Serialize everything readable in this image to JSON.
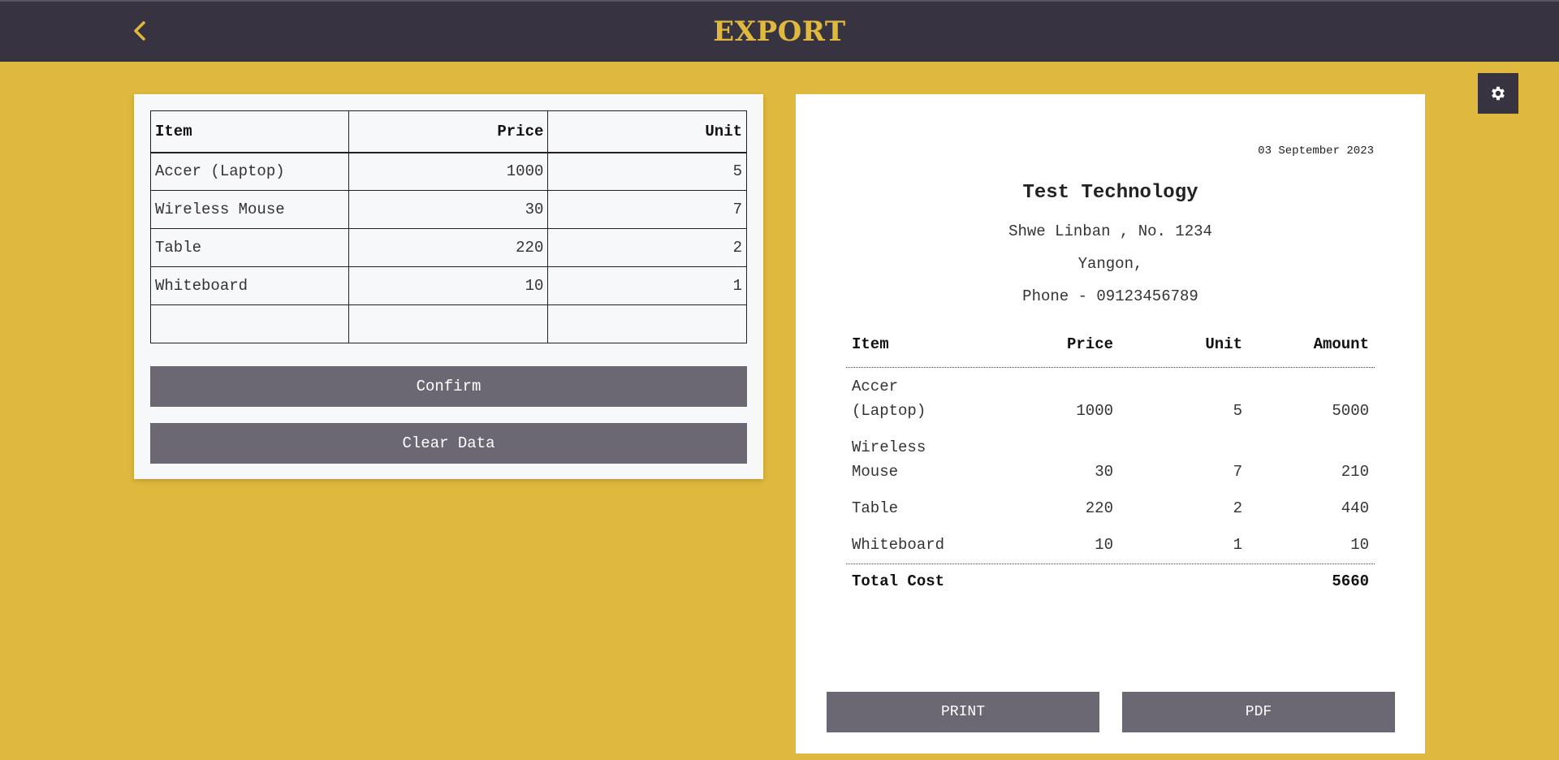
{
  "header": {
    "title": "EXPORT",
    "back_icon": "chevron-left-icon",
    "accent_color": "#dfb83e",
    "bar_color": "#383341"
  },
  "settings": {
    "icon": "gear-icon"
  },
  "input_table": {
    "columns": [
      "Item",
      "Price",
      "Unit"
    ],
    "rows": [
      [
        "Accer (Laptop)",
        "1000",
        "5"
      ],
      [
        "Wireless Mouse",
        "30",
        "7"
      ],
      [
        "Table",
        "220",
        "2"
      ],
      [
        "Whiteboard",
        "10",
        "1"
      ],
      [
        "",
        "",
        ""
      ]
    ]
  },
  "actions": {
    "confirm_label": "Confirm",
    "clear_label": "Clear Data"
  },
  "receipt": {
    "date": "03 September 2023",
    "company": "Test Technology",
    "address_line1": "Shwe Linban , No. 1234",
    "address_line2": "Yangon,",
    "phone_line": "Phone - 09123456789",
    "columns": [
      "Item",
      "Price",
      "Unit",
      "Amount"
    ],
    "rows": [
      {
        "item1": "Accer",
        "item2": "(Laptop)",
        "price": "1000",
        "unit": "5",
        "amount": "5000"
      },
      {
        "item1": "Wireless",
        "item2": "Mouse",
        "price": "30",
        "unit": "7",
        "amount": "210"
      },
      {
        "item1": "Table",
        "item2": "",
        "price": "220",
        "unit": "2",
        "amount": "440"
      },
      {
        "item1": "Whiteboard",
        "item2": "",
        "price": "10",
        "unit": "1",
        "amount": "10"
      }
    ],
    "total_label": "Total Cost",
    "total_value": "5660",
    "print_label": "PRINT",
    "pdf_label": "PDF"
  }
}
